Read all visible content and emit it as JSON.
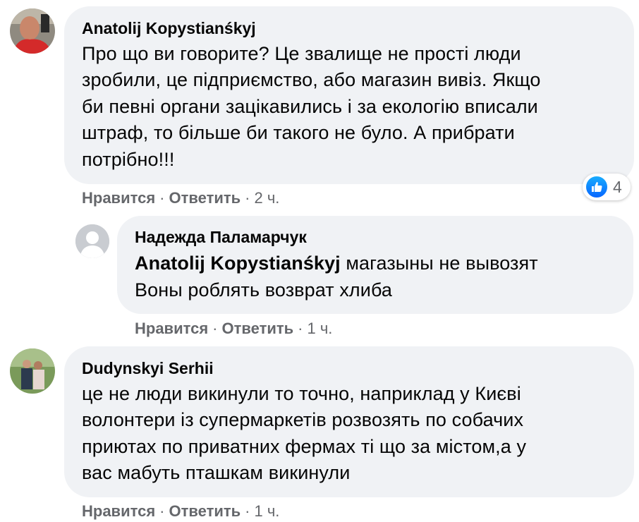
{
  "comments": [
    {
      "author": "Anatolij Kopystianśkyj",
      "lines": [
        "Про що ви говорите? Це звалище не прості люди",
        "зробили, це підприємство, або магазин вивіз. Якщо",
        "би певні органи зацікавились і за екологію вписали",
        "штраф, то більше би такого не було. А прибрати",
        "потрібно!!!"
      ],
      "like_label": "Нравится",
      "reply_label": "Ответить",
      "time": "2 ч.",
      "reaction_icon": "like-icon",
      "reaction_count": "4"
    },
    {
      "author": "Надежда Паламарчук",
      "mention": "Anatolij Kopystianśkyj",
      "line1_rest": " магазыны не вывозят",
      "line2": "Воны роблять возврат хлиба",
      "like_label": "Нравится",
      "reply_label": "Ответить",
      "time": "1 ч."
    },
    {
      "author": "Dudynskyi Serhii",
      "lines": [
        "це не люди викинули то точно, наприклад у Києві",
        "волонтери із супермаркетів розвозять по собачих",
        "приютах по приватних фермах ті що за містом,а у",
        "вас мабуть пташкам викинули"
      ],
      "like_label": "Нравится",
      "reply_label": "Ответить",
      "time": "1 ч."
    }
  ],
  "colors": {
    "bubble": "#f0f2f5",
    "meta_text": "#65676b",
    "like_blue": "#0866ff"
  }
}
